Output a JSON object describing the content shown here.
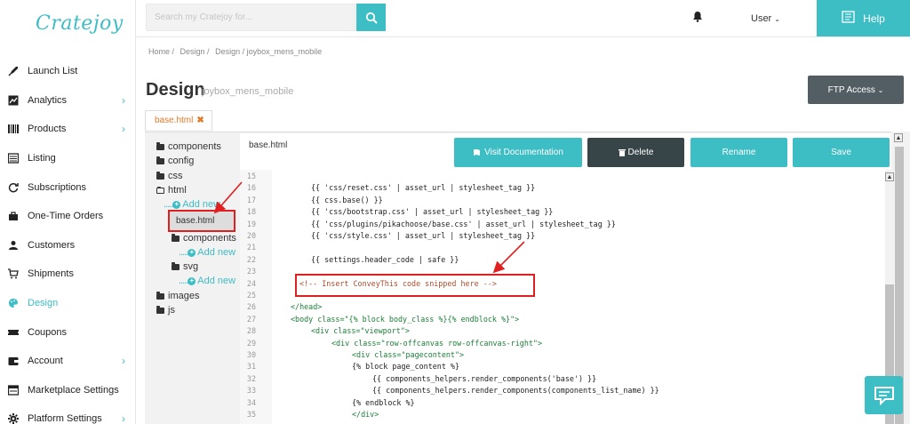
{
  "app": {
    "logo": "Cratejoy"
  },
  "header": {
    "search_placeholder": "Search my Cratejoy for...",
    "user_label": "User",
    "help_label": "Help"
  },
  "sidebar": {
    "items": [
      {
        "label": "Launch List",
        "icon": "rocket-icon",
        "chevron": false,
        "active": false
      },
      {
        "label": "Analytics",
        "icon": "chart-icon",
        "chevron": true,
        "active": false
      },
      {
        "label": "Products",
        "icon": "barcode-icon",
        "chevron": true,
        "active": false
      },
      {
        "label": "Listing",
        "icon": "list-icon",
        "chevron": false,
        "active": false
      },
      {
        "label": "Subscriptions",
        "icon": "refresh-icon",
        "chevron": false,
        "active": false
      },
      {
        "label": "One-Time Orders",
        "icon": "bag-icon",
        "chevron": false,
        "active": false
      },
      {
        "label": "Customers",
        "icon": "person-icon",
        "chevron": false,
        "active": false
      },
      {
        "label": "Shipments",
        "icon": "cart-icon",
        "chevron": false,
        "active": false
      },
      {
        "label": "Design",
        "icon": "palette-icon",
        "chevron": false,
        "active": true
      },
      {
        "label": "Coupons",
        "icon": "ticket-icon",
        "chevron": false,
        "active": false
      },
      {
        "label": "Account",
        "icon": "wallet-icon",
        "chevron": true,
        "active": false
      },
      {
        "label": "Marketplace Settings",
        "icon": "store-icon",
        "chevron": false,
        "active": false
      },
      {
        "label": "Platform Settings",
        "icon": "cog-icon",
        "chevron": true,
        "active": false
      }
    ]
  },
  "breadcrumb": [
    "Home /",
    "Design /",
    "Design / joybox_mens_mobile"
  ],
  "page": {
    "title": "Design",
    "subtitle": "joybox_mens_mobile",
    "ftp_label": "FTP Access"
  },
  "file_tab": {
    "label": "base.html",
    "close": "✖"
  },
  "tree": {
    "components": "components",
    "config": "config",
    "css": "css",
    "html": "html",
    "add_new": "Add new",
    "base_html": "base.html",
    "html_components": "components",
    "svg": "svg",
    "images": "images",
    "js": "js"
  },
  "editor": {
    "filename": "base.html",
    "btn_docs": "Visit Documentation",
    "btn_delete": "Delete",
    "btn_rename": "Rename",
    "btn_save": "Save"
  },
  "code_lines": [
    {
      "n": "15",
      "t": ""
    },
    {
      "n": "16",
      "t": "{{ 'css/reset.css' | asset_url | stylesheet_tag }}"
    },
    {
      "n": "17",
      "t": "{{ css.base() }}"
    },
    {
      "n": "18",
      "t": "{{ 'css/bootstrap.css' | asset_url | stylesheet_tag }}"
    },
    {
      "n": "19",
      "t": "{{ 'css/plugins/pikachoose/base.css' | asset_url | stylesheet_tag }}"
    },
    {
      "n": "20",
      "t": "{{ 'css/style.css' | asset_url | stylesheet_tag }}"
    },
    {
      "n": "21",
      "t": ""
    },
    {
      "n": "22",
      "t": "{{ settings.header_code | safe }}"
    },
    {
      "n": "23",
      "t": ""
    },
    {
      "n": "24",
      "t": "<!-- Insert ConveyThis code snipped here -->"
    },
    {
      "n": "25",
      "t": ""
    },
    {
      "n": "26",
      "t": "</head>"
    },
    {
      "n": "27",
      "t": "<body class=\"{% block body_class %}{% endblock %}\">"
    },
    {
      "n": "28",
      "t": "<div class=\"viewport\">"
    },
    {
      "n": "29",
      "t": "<div class=\"row-offcanvas row-offcanvas-right\">"
    },
    {
      "n": "30",
      "t": "<div class=\"pagecontent\">"
    },
    {
      "n": "31",
      "t": "{% block page_content %}"
    },
    {
      "n": "32",
      "t": "{{ components_helpers.render_components('base') }}"
    },
    {
      "n": "33",
      "t": "{{ components_helpers.render_components(components_list_name) }}"
    },
    {
      "n": "34",
      "t": "{% endblock %}"
    },
    {
      "n": "35",
      "t": "</div>"
    }
  ]
}
